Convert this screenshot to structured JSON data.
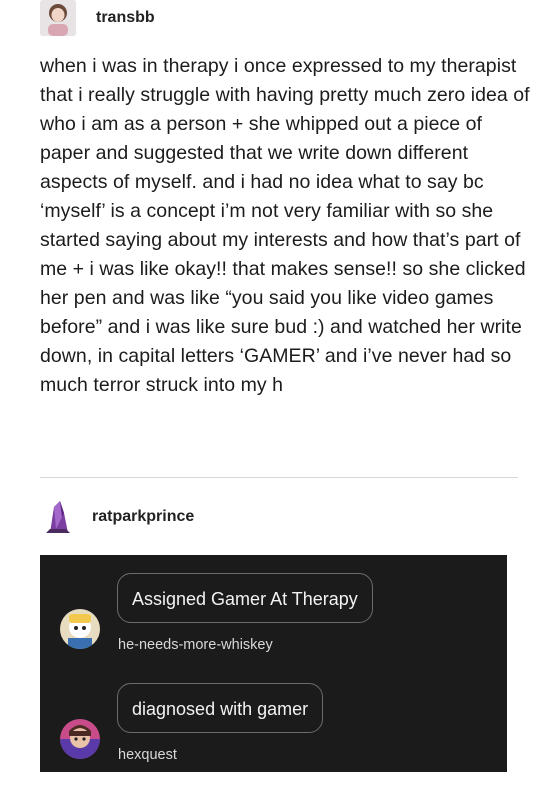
{
  "original_post": {
    "username": "transbb",
    "avatar_icon": "user-avatar-icon",
    "text": "when i was in therapy i once expressed to my therapist that i really struggle with having pretty much zero idea of who i am as a person + she whipped out a piece of paper and suggested that we write down different aspects of myself. and i had no idea what to say bc ‘myself’ is a concept i’m not very familiar with so she started saying about my interests and how that’s part of me + i was like okay!! that makes sense!! so she clicked her pen and was like “you said you like video games before” and i was like sure bud :) and watched her write down, in capital letters ‘GAMER’ and i’ve never had so much terror struck into my h"
  },
  "reblog": {
    "username": "ratparkprince",
    "avatar_icon": "crystal-avatar-icon"
  },
  "replies": [
    {
      "text": "Assigned Gamer At Therapy",
      "username": "he-needs-more-whiskey",
      "avatar_icon": "cartoon-avatar-icon"
    },
    {
      "text": "diagnosed with gamer",
      "username": "hexquest",
      "avatar_icon": "character-avatar-icon"
    }
  ],
  "colors": {
    "background": "#ffffff",
    "text": "#1c1c1c",
    "panel": "#1b1b1b",
    "reply_text": "#f2f2f2",
    "crystal": "#7a3fa0"
  }
}
